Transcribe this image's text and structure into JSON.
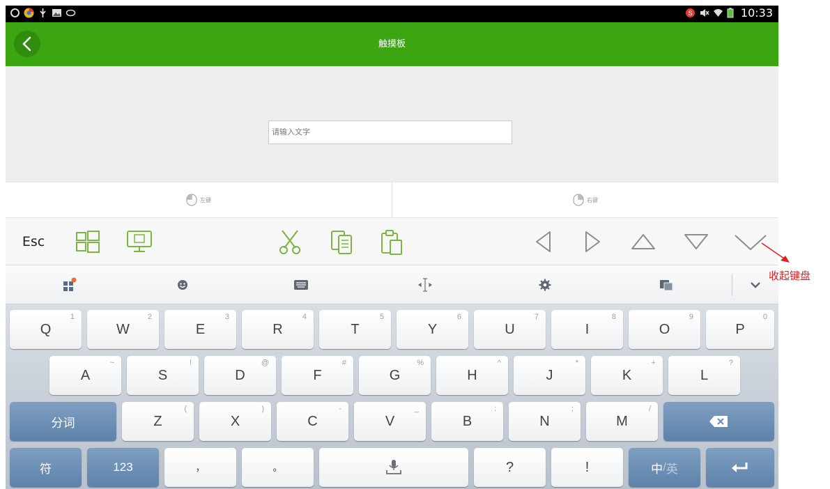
{
  "status_bar": {
    "time": "10:33",
    "icons_left": [
      "app-icon",
      "chrome-icon",
      "usb-icon",
      "image-icon",
      "signal-icon"
    ],
    "icons_right": [
      "notification-icon",
      "mute-icon",
      "wifi-icon",
      "battery-icon"
    ]
  },
  "header": {
    "title": "触摸板",
    "back_icon": "chevron-left-icon",
    "color": "#3ca512"
  },
  "input": {
    "placeholder": "请输入文字",
    "value": ""
  },
  "mouse_buttons": {
    "left_label": "左键",
    "right_label": "右键"
  },
  "toolbar": {
    "esc_label": "Esc",
    "items": [
      "windows-icon",
      "desktop-icon",
      "cut-icon",
      "copy-icon",
      "paste-icon",
      "arrow-left-icon",
      "arrow-right-icon",
      "arrow-up-icon",
      "arrow-down-icon",
      "hide-keyboard-icon"
    ],
    "accent": "#7ab640"
  },
  "ime_bar": {
    "items": [
      "apps-icon",
      "emoji-icon",
      "keyboard-icon",
      "cursor-icon",
      "settings-icon",
      "clipboard-icon",
      "collapse-icon"
    ]
  },
  "keyboard": {
    "row1": [
      {
        "key": "Q",
        "sub": "1"
      },
      {
        "key": "W",
        "sub": "2"
      },
      {
        "key": "E",
        "sub": "3"
      },
      {
        "key": "R",
        "sub": "4"
      },
      {
        "key": "T",
        "sub": "5"
      },
      {
        "key": "Y",
        "sub": "6"
      },
      {
        "key": "U",
        "sub": "7"
      },
      {
        "key": "I",
        "sub": "8"
      },
      {
        "key": "O",
        "sub": "9"
      },
      {
        "key": "P",
        "sub": "0"
      }
    ],
    "row2": [
      {
        "key": "A",
        "sub": "~"
      },
      {
        "key": "S",
        "sub": "!"
      },
      {
        "key": "D",
        "sub": "@"
      },
      {
        "key": "F",
        "sub": "#"
      },
      {
        "key": "G",
        "sub": "%"
      },
      {
        "key": "H",
        "sub": "^"
      },
      {
        "key": "J",
        "sub": "*"
      },
      {
        "key": "K",
        "sub": "+"
      },
      {
        "key": "L",
        "sub": "?"
      }
    ],
    "row3": [
      {
        "key": "Z",
        "sub": "("
      },
      {
        "key": "X",
        "sub": ")"
      },
      {
        "key": "C",
        "sub": "-"
      },
      {
        "key": "V",
        "sub": "_"
      },
      {
        "key": "B",
        "sub": ":"
      },
      {
        "key": "N",
        "sub": ";"
      },
      {
        "key": "M",
        "sub": "/"
      }
    ],
    "fenci": "分词",
    "fu": "符",
    "num": "123",
    "comma": "，",
    "period": "。",
    "question": "?",
    "exclaim": "!",
    "lang_zh": "中",
    "lang_sep": "/",
    "lang_en": "英",
    "key_color": "#f4f5f6",
    "special_color": "#6b8fb8"
  },
  "annotation": {
    "text": "收起键盘",
    "color": "#e02020"
  }
}
